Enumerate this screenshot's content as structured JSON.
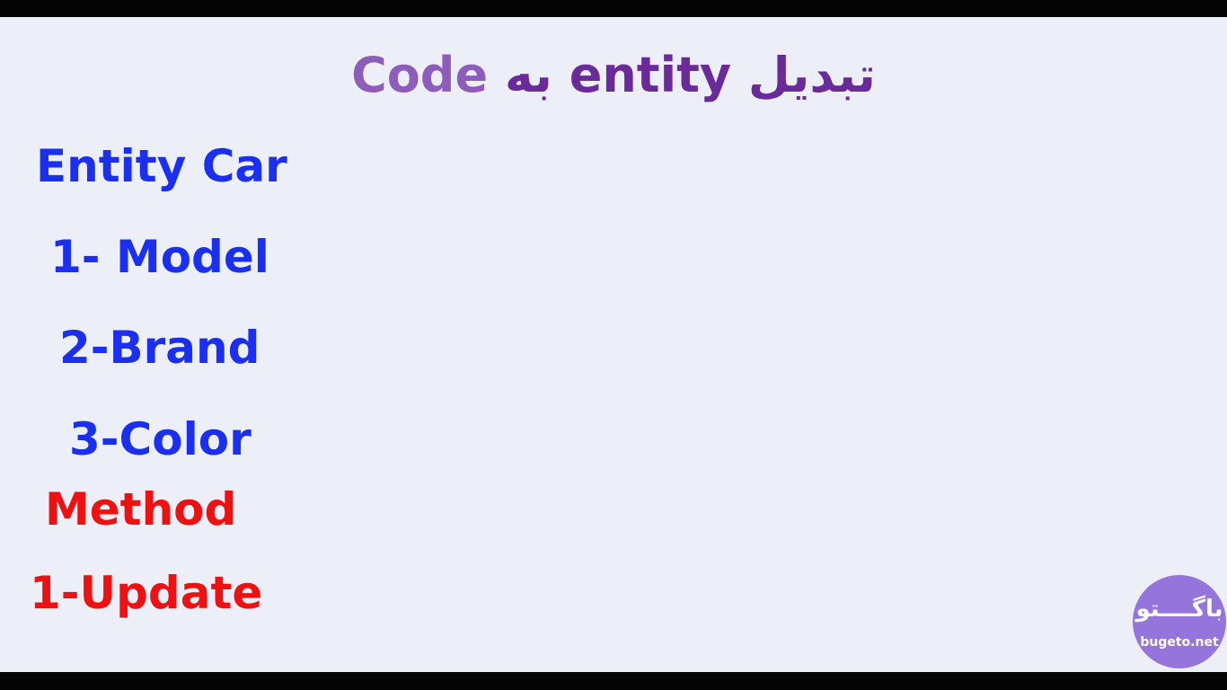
{
  "slide": {
    "title": {
      "left_part": "Code",
      "right_part": "تبدیل entity به"
    },
    "items": [
      {
        "text": "Entity Car",
        "color": "#1a2ff0"
      },
      {
        "text": "1- Model",
        "color": "#1a2ff0"
      },
      {
        "text": "2-Brand",
        "color": "#1a2ff0"
      },
      {
        "text": "3-Color",
        "color": "#1a2ff0"
      },
      {
        "text": "Method",
        "color": "#ee1111"
      },
      {
        "text": "1-Update",
        "color": "#ee1111"
      }
    ]
  },
  "watermark": {
    "name": "باگــــتو",
    "url": "bugeto.net",
    "color": "#9575dc"
  }
}
